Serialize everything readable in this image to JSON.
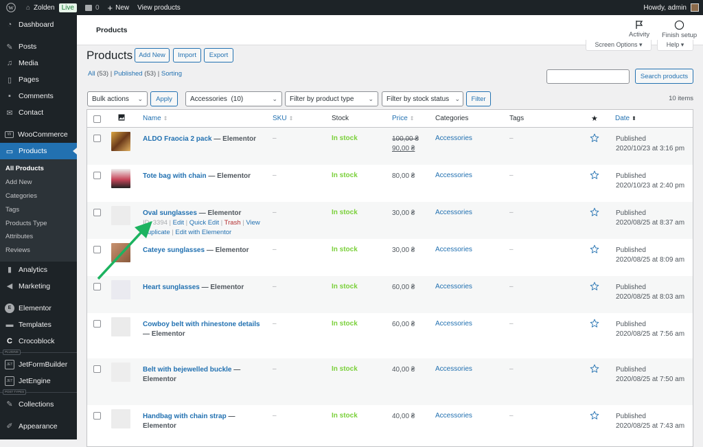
{
  "adminbar": {
    "site_name": "Zolden",
    "live_badge": "Live",
    "comments_count": "0",
    "new_label": "New",
    "view_products": "View products",
    "howdy": "Howdy, admin"
  },
  "sidebar": {
    "items_top": [
      {
        "label": "Dashboard",
        "icon": "dashboard-icon"
      },
      {
        "label": "Posts",
        "icon": "pin-icon"
      },
      {
        "label": "Media",
        "icon": "media-icon"
      },
      {
        "label": "Pages",
        "icon": "pages-icon"
      },
      {
        "label": "Comments",
        "icon": "comment-icon"
      },
      {
        "label": "Contact",
        "icon": "envelope-icon"
      },
      {
        "label": "WooCommerce",
        "icon": "woocommerce-icon"
      },
      {
        "label": "Products",
        "icon": "archive-icon"
      }
    ],
    "submenu": [
      "All Products",
      "Add New",
      "Categories",
      "Tags",
      "Products Type",
      "Attributes",
      "Reviews"
    ],
    "items_bottom": [
      {
        "label": "Analytics",
        "icon": "chart-bar-icon"
      },
      {
        "label": "Marketing",
        "icon": "megaphone-icon"
      },
      {
        "label": "Elementor",
        "icon": "elementor-icon"
      },
      {
        "label": "Templates",
        "icon": "folder-icon"
      },
      {
        "label": "Crocoblock",
        "icon": "crocoblock-icon"
      }
    ],
    "section_plugins": "PLUGINS",
    "plugins": [
      {
        "label": "JetFormBuilder",
        "icon": "jet-icon"
      },
      {
        "label": "JetEngine",
        "icon": "jet-icon"
      }
    ],
    "section_post_types": "POST TYPES",
    "post_types": [
      {
        "label": "Collections",
        "icon": "pin-icon"
      }
    ],
    "appearance": {
      "label": "Appearance",
      "icon": "brush-icon"
    }
  },
  "wc_header": {
    "title": "Products",
    "activity": "Activity",
    "finish_setup": "Finish setup",
    "screen_options": "Screen Options ▾",
    "help": "Help ▾"
  },
  "page": {
    "title": "Products",
    "add_new": "Add New",
    "import": "Import",
    "export": "Export",
    "views": {
      "all": "All",
      "all_count": "(53)",
      "published": "Published",
      "published_count": "(53)",
      "sorting": "Sorting"
    },
    "search_placeholder": "",
    "search_button": "Search products",
    "bulk_actions": "Bulk actions",
    "apply": "Apply",
    "category_filter": "Accessories  (10)",
    "type_filter": "Filter by product type",
    "stock_filter": "Filter by stock status",
    "filter_button": "Filter",
    "items_count": "10 items"
  },
  "table": {
    "columns": {
      "name": "Name",
      "sku": "SKU",
      "stock": "Stock",
      "price": "Price",
      "categories": "Categories",
      "tags": "Tags",
      "date": "Date"
    },
    "rows": [
      {
        "name": "ALDO Fraocia 2 pack",
        "suffix": "— Elementor",
        "sku": "–",
        "stock": "In stock",
        "price_regular": "100,00 ₴",
        "price_sale": "90,00 ₴",
        "category": "Accessories",
        "tags": "–",
        "status": "Published",
        "date": "2020/10/23 at 3:16 pm"
      },
      {
        "name": "Tote bag with chain",
        "suffix": "— Elementor",
        "sku": "–",
        "stock": "In stock",
        "price": "80,00 ₴",
        "category": "Accessories",
        "tags": "–",
        "status": "Published",
        "date": "2020/10/23 at 2:40 pm"
      },
      {
        "name": "Oval sunglasses",
        "suffix": "— Elementor",
        "sku": "–",
        "stock": "In stock",
        "price": "30,00 ₴",
        "category": "Accessories",
        "tags": "–",
        "status": "Published",
        "date": "2020/08/25 at 8:37 am",
        "row_actions": {
          "id": "ID: 3394",
          "edit": "Edit",
          "quick_edit": "Quick Edit",
          "trash": "Trash",
          "view": "View",
          "duplicate": "Duplicate",
          "edit_elementor": "Edit with Elementor"
        }
      },
      {
        "name": "Cateye sunglasses",
        "suffix": "— Elementor",
        "sku": "–",
        "stock": "In stock",
        "price": "30,00 ₴",
        "category": "Accessories",
        "tags": "–",
        "status": "Published",
        "date": "2020/08/25 at 8:09 am"
      },
      {
        "name": "Heart sunglasses",
        "suffix": "— Elementor",
        "sku": "–",
        "stock": "In stock",
        "price": "60,00 ₴",
        "category": "Accessories",
        "tags": "–",
        "status": "Published",
        "date": "2020/08/25 at 8:03 am"
      },
      {
        "name": "Cowboy belt with rhinestone details",
        "suffix": "— Elementor",
        "sku": "–",
        "stock": "In stock",
        "price": "60,00 ₴",
        "category": "Accessories",
        "tags": "–",
        "status": "Published",
        "date": "2020/08/25 at 7:56 am"
      },
      {
        "name": "Belt with bejewelled buckle",
        "suffix": "— Elementor",
        "sku": "–",
        "stock": "In stock",
        "price": "40,00 ₴",
        "category": "Accessories",
        "tags": "–",
        "status": "Published",
        "date": "2020/08/25 at 7:50 am"
      },
      {
        "name": "Handbag with chain strap",
        "suffix": "— Elementor",
        "sku": "–",
        "stock": "In stock",
        "price": "40,00 ₴",
        "category": "Accessories",
        "tags": "–",
        "status": "Published",
        "date": "2020/08/25 at 7:43 am"
      }
    ]
  },
  "colors": {
    "accent": "#2271b1",
    "in_stock": "#7ad03a",
    "trash": "#b32d2e",
    "annotation_arrow": "#1db360"
  }
}
